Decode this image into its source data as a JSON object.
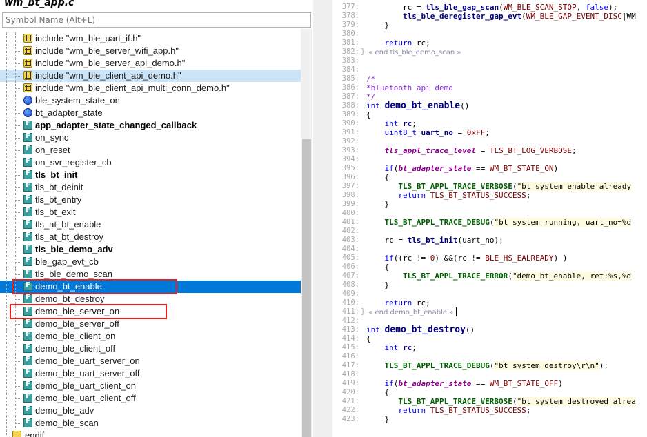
{
  "window": {
    "title": "wm_bt_app.c"
  },
  "search": {
    "placeholder": "Symbol Name (Alt+L)"
  },
  "symbol_tree": [
    {
      "label": "include \"wm_ble_uart_if.h\"",
      "icon": "include-icon",
      "bold": false,
      "state": ""
    },
    {
      "label": "include \"wm_ble_server_wifi_app.h\"",
      "icon": "include-icon",
      "bold": false,
      "state": ""
    },
    {
      "label": "include \"wm_ble_server_api_demo.h\"",
      "icon": "include-icon",
      "bold": false,
      "state": ""
    },
    {
      "label": "include \"wm_ble_client_api_demo.h\"",
      "icon": "include-icon",
      "bold": false,
      "state": "hover"
    },
    {
      "label": "include \"wm_ble_client_api_multi_conn_demo.h\"",
      "icon": "include-icon",
      "bold": false,
      "state": ""
    },
    {
      "label": "ble_system_state_on",
      "icon": "variable-icon",
      "bold": false,
      "state": ""
    },
    {
      "label": "bt_adapter_state",
      "icon": "variable-icon",
      "bold": false,
      "state": ""
    },
    {
      "label": "app_adapter_state_changed_callback",
      "icon": "function-icon",
      "bold": true,
      "state": ""
    },
    {
      "label": "on_sync",
      "icon": "function-icon",
      "bold": false,
      "state": ""
    },
    {
      "label": "on_reset",
      "icon": "function-icon",
      "bold": false,
      "state": ""
    },
    {
      "label": "on_svr_register_cb",
      "icon": "function-icon",
      "bold": false,
      "state": ""
    },
    {
      "label": "tls_bt_init",
      "icon": "function-icon",
      "bold": true,
      "state": ""
    },
    {
      "label": "tls_bt_deinit",
      "icon": "function-icon",
      "bold": false,
      "state": ""
    },
    {
      "label": "tls_bt_entry",
      "icon": "function-icon",
      "bold": false,
      "state": ""
    },
    {
      "label": "tls_bt_exit",
      "icon": "function-icon",
      "bold": false,
      "state": ""
    },
    {
      "label": "tls_at_bt_enable",
      "icon": "function-icon",
      "bold": false,
      "state": ""
    },
    {
      "label": "tls_at_bt_destroy",
      "icon": "function-icon",
      "bold": false,
      "state": ""
    },
    {
      "label": "tls_ble_demo_adv",
      "icon": "function-icon",
      "bold": true,
      "state": ""
    },
    {
      "label": "ble_gap_evt_cb",
      "icon": "function-icon",
      "bold": false,
      "state": ""
    },
    {
      "label": "tls_ble_demo_scan",
      "icon": "function-icon",
      "bold": false,
      "state": ""
    },
    {
      "label": "demo_bt_enable",
      "icon": "function-icon",
      "bold": false,
      "state": "selected"
    },
    {
      "label": "demo_bt_destroy",
      "icon": "function-icon",
      "bold": false,
      "state": ""
    },
    {
      "label": "demo_ble_server_on",
      "icon": "function-icon",
      "bold": false,
      "state": ""
    },
    {
      "label": "demo_ble_server_off",
      "icon": "function-icon",
      "bold": false,
      "state": ""
    },
    {
      "label": "demo_ble_client_on",
      "icon": "function-icon",
      "bold": false,
      "state": ""
    },
    {
      "label": "demo_ble_client_off",
      "icon": "function-icon",
      "bold": false,
      "state": ""
    },
    {
      "label": "demo_ble_uart_server_on",
      "icon": "function-icon",
      "bold": false,
      "state": ""
    },
    {
      "label": "demo_ble_uart_server_off",
      "icon": "function-icon",
      "bold": false,
      "state": ""
    },
    {
      "label": "demo_ble_uart_client_on",
      "icon": "function-icon",
      "bold": false,
      "state": ""
    },
    {
      "label": "demo_ble_uart_client_off",
      "icon": "function-icon",
      "bold": false,
      "state": ""
    },
    {
      "label": "demo_ble_adv",
      "icon": "function-icon",
      "bold": false,
      "state": ""
    },
    {
      "label": "demo_ble_scan",
      "icon": "function-icon",
      "bold": false,
      "state": ""
    },
    {
      "label": "endif",
      "icon": "endif-icon",
      "bold": false,
      "state": ""
    }
  ],
  "highlights": [
    "demo_bt_enable",
    "demo_ble_server_on"
  ],
  "highlight_color": "#e8201c",
  "selection_color": "#0078d7",
  "editor_lines": [
    {
      "n": "377:",
      "fold": "",
      "seg": [
        [
          "",
          "        "
        ],
        [
          "plain",
          "rc = "
        ],
        [
          "var",
          "tls_ble_gap_scan"
        ],
        [
          "plain",
          "("
        ],
        [
          "mac",
          "WM_BLE_SCAN_STOP"
        ],
        [
          "plain",
          ", "
        ],
        [
          "kw",
          "false"
        ],
        [
          "plain",
          ");"
        ]
      ]
    },
    {
      "n": "378:",
      "fold": "",
      "seg": [
        [
          "",
          "        "
        ],
        [
          "var",
          "tls_ble_deregister_gap_evt"
        ],
        [
          "plain",
          "("
        ],
        [
          "mac",
          "WM_BLE_GAP_EVENT_DISC"
        ],
        [
          "plain",
          "|WM"
        ]
      ]
    },
    {
      "n": "379:",
      "fold": "",
      "seg": [
        [
          "",
          "    "
        ],
        [
          "plain",
          "}"
        ]
      ]
    },
    {
      "n": "380:",
      "fold": "",
      "seg": []
    },
    {
      "n": "381:",
      "fold": "",
      "seg": [
        [
          "",
          "    "
        ],
        [
          "kw",
          "return"
        ],
        [
          "plain",
          " rc;"
        ]
      ]
    },
    {
      "n": "382:",
      "fold": "}",
      "seg": [
        [
          "mark",
          " « end tls_ble_demo_scan »"
        ]
      ]
    },
    {
      "n": "383:",
      "fold": "",
      "seg": []
    },
    {
      "n": "384:",
      "fold": "",
      "seg": []
    },
    {
      "n": "385:",
      "fold": "",
      "seg": [
        [
          "cm",
          "/*"
        ]
      ]
    },
    {
      "n": "386:",
      "fold": "",
      "seg": [
        [
          "cm",
          "*bluetooth api demo"
        ]
      ]
    },
    {
      "n": "387:",
      "fold": "",
      "seg": [
        [
          "cm",
          "*/"
        ]
      ]
    },
    {
      "n": "388:",
      "fold": "",
      "seg": [
        [
          "ty",
          "int "
        ],
        [
          "def",
          "demo_bt_enable"
        ],
        [
          "plain",
          "()"
        ]
      ]
    },
    {
      "n": "389:",
      "fold": "",
      "seg": [
        [
          "plain",
          "{"
        ]
      ]
    },
    {
      "n": "390:",
      "fold": "",
      "seg": [
        [
          "",
          "    "
        ],
        [
          "ty",
          "int "
        ],
        [
          "var",
          "rc"
        ],
        [
          "plain",
          ";"
        ]
      ]
    },
    {
      "n": "391:",
      "fold": "",
      "seg": [
        [
          "",
          "    "
        ],
        [
          "ty",
          "uint8_t "
        ],
        [
          "var",
          "uart_no"
        ],
        [
          "plain",
          " = "
        ],
        [
          "mac",
          "0xFF"
        ],
        [
          "plain",
          ";"
        ]
      ]
    },
    {
      "n": "392:",
      "fold": "",
      "seg": []
    },
    {
      "n": "393:",
      "fold": "",
      "seg": [
        [
          "",
          "    "
        ],
        [
          "it",
          "tls_appl_trace_level"
        ],
        [
          "plain",
          " = "
        ],
        [
          "mac",
          "TLS_BT_LOG_VERBOSE"
        ],
        [
          "plain",
          ";"
        ]
      ]
    },
    {
      "n": "394:",
      "fold": "",
      "seg": []
    },
    {
      "n": "395:",
      "fold": "",
      "seg": [
        [
          "",
          "    "
        ],
        [
          "kw",
          "if"
        ],
        [
          "plain",
          "("
        ],
        [
          "it",
          "bt_adapter_state"
        ],
        [
          "plain",
          " == "
        ],
        [
          "mac",
          "WM_BT_STATE_ON"
        ],
        [
          "plain",
          ")"
        ]
      ]
    },
    {
      "n": "396:",
      "fold": "",
      "seg": [
        [
          "",
          "    "
        ],
        [
          "plain",
          "{"
        ]
      ]
    },
    {
      "n": "397:",
      "fold": "",
      "seg": [
        [
          "",
          "       "
        ],
        [
          "grn",
          "TLS_BT_APPL_TRACE_VERBOSE"
        ],
        [
          "plain",
          "("
        ],
        [
          "str",
          "\"bt system enable already"
        ]
      ]
    },
    {
      "n": "398:",
      "fold": "",
      "seg": [
        [
          "",
          "       "
        ],
        [
          "kw",
          "return "
        ],
        [
          "mac",
          "TLS_BT_STATUS_SUCCESS"
        ],
        [
          "plain",
          ";"
        ]
      ]
    },
    {
      "n": "399:",
      "fold": "",
      "seg": [
        [
          "",
          "    "
        ],
        [
          "plain",
          "}"
        ]
      ]
    },
    {
      "n": "400:",
      "fold": "",
      "seg": []
    },
    {
      "n": "401:",
      "fold": "",
      "seg": [
        [
          "",
          "    "
        ],
        [
          "grn",
          "TLS_BT_APPL_TRACE_DEBUG"
        ],
        [
          "plain",
          "("
        ],
        [
          "str",
          "\"bt system running, uart_no=%d"
        ]
      ]
    },
    {
      "n": "402:",
      "fold": "",
      "seg": []
    },
    {
      "n": "403:",
      "fold": "",
      "seg": [
        [
          "",
          "    "
        ],
        [
          "plain",
          "rc = "
        ],
        [
          "var",
          "tls_bt_init"
        ],
        [
          "plain",
          "(uart_no);"
        ]
      ]
    },
    {
      "n": "404:",
      "fold": "",
      "seg": []
    },
    {
      "n": "405:",
      "fold": "",
      "seg": [
        [
          "",
          "    "
        ],
        [
          "kw",
          "if"
        ],
        [
          "plain",
          "((rc != "
        ],
        [
          "mac",
          "0"
        ],
        [
          "plain",
          ") &&(rc != "
        ],
        [
          "mac",
          "BLE_HS_EALREADY"
        ],
        [
          "plain",
          ") )"
        ]
      ]
    },
    {
      "n": "406:",
      "fold": "",
      "seg": [
        [
          "",
          "    "
        ],
        [
          "plain",
          "{"
        ]
      ]
    },
    {
      "n": "407:",
      "fold": "",
      "seg": [
        [
          "",
          "        "
        ],
        [
          "grn",
          "TLS_BT_APPL_TRACE_ERROR"
        ],
        [
          "plain",
          "("
        ],
        [
          "str",
          "\"demo_bt_enable, ret:%s,%d"
        ]
      ]
    },
    {
      "n": "408:",
      "fold": "",
      "seg": [
        [
          "",
          "    "
        ],
        [
          "plain",
          "}"
        ]
      ]
    },
    {
      "n": "409:",
      "fold": "",
      "seg": []
    },
    {
      "n": "410:",
      "fold": "",
      "seg": [
        [
          "",
          "    "
        ],
        [
          "kw",
          "return"
        ],
        [
          "plain",
          " rc;"
        ]
      ]
    },
    {
      "n": "411:",
      "fold": "}",
      "seg": [
        [
          "mark",
          " « end demo_bt_enable »"
        ],
        [
          "caret",
          ""
        ]
      ]
    },
    {
      "n": "412:",
      "fold": "",
      "seg": []
    },
    {
      "n": "413:",
      "fold": "",
      "seg": [
        [
          "ty",
          "int "
        ],
        [
          "def",
          "demo_bt_destroy"
        ],
        [
          "plain",
          "()"
        ]
      ]
    },
    {
      "n": "414:",
      "fold": "",
      "seg": [
        [
          "plain",
          "{"
        ]
      ]
    },
    {
      "n": "415:",
      "fold": "",
      "seg": [
        [
          "",
          "    "
        ],
        [
          "ty",
          "int "
        ],
        [
          "var",
          "rc"
        ],
        [
          "plain",
          ";"
        ]
      ]
    },
    {
      "n": "416:",
      "fold": "",
      "seg": []
    },
    {
      "n": "417:",
      "fold": "",
      "seg": [
        [
          "",
          "    "
        ],
        [
          "grn",
          "TLS_BT_APPL_TRACE_DEBUG"
        ],
        [
          "plain",
          "("
        ],
        [
          "str",
          "\"bt system destroy\\r\\n\""
        ],
        [
          "plain",
          ");"
        ]
      ]
    },
    {
      "n": "418:",
      "fold": "",
      "seg": []
    },
    {
      "n": "419:",
      "fold": "",
      "seg": [
        [
          "",
          "    "
        ],
        [
          "kw",
          "if"
        ],
        [
          "plain",
          "("
        ],
        [
          "it",
          "bt_adapter_state"
        ],
        [
          "plain",
          " == "
        ],
        [
          "mac",
          "WM_BT_STATE_OFF"
        ],
        [
          "plain",
          ")"
        ]
      ]
    },
    {
      "n": "420:",
      "fold": "",
      "seg": [
        [
          "",
          "    "
        ],
        [
          "plain",
          "{"
        ]
      ]
    },
    {
      "n": "421:",
      "fold": "",
      "seg": [
        [
          "",
          "       "
        ],
        [
          "grn",
          "TLS_BT_APPL_TRACE_VERBOSE"
        ],
        [
          "plain",
          "("
        ],
        [
          "str",
          "\"bt system destroyed alrea"
        ]
      ]
    },
    {
      "n": "422:",
      "fold": "",
      "seg": [
        [
          "",
          "       "
        ],
        [
          "kw",
          "return "
        ],
        [
          "mac",
          "TLS_BT_STATUS_SUCCESS"
        ],
        [
          "plain",
          ";"
        ]
      ]
    },
    {
      "n": "423:",
      "fold": "",
      "seg": [
        [
          "",
          "    "
        ],
        [
          "plain",
          "}"
        ]
      ]
    }
  ]
}
